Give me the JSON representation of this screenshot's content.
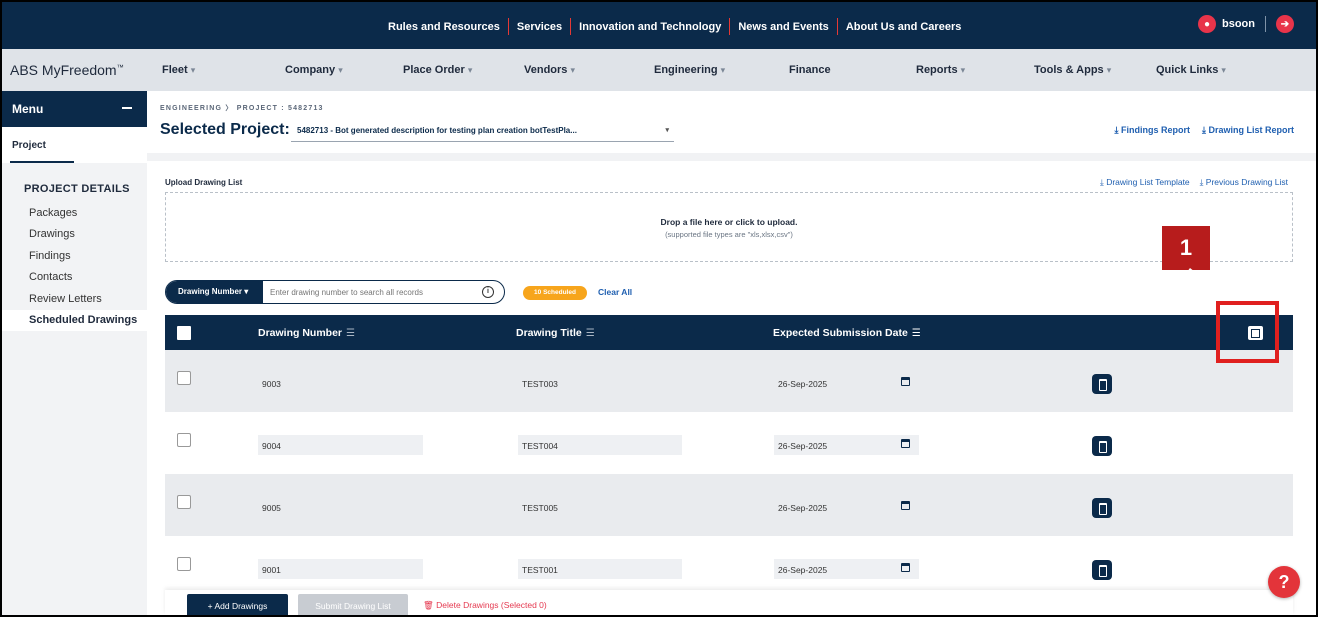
{
  "topnav": {
    "links": [
      "Rules and Resources",
      "Services",
      "Innovation and Technology",
      "News and Events",
      "About Us and Careers"
    ],
    "username": "bsoon"
  },
  "mainnav": {
    "brand": "ABS MyFreedom",
    "brand_mark": "™",
    "items": [
      {
        "label": "Fleet",
        "has_dropdown": true
      },
      {
        "label": "Company",
        "has_dropdown": true
      },
      {
        "label": "Place Order",
        "has_dropdown": true
      },
      {
        "label": "Vendors",
        "has_dropdown": true
      },
      {
        "label": "Engineering",
        "has_dropdown": true
      },
      {
        "label": "Finance",
        "has_dropdown": false
      },
      {
        "label": "Reports",
        "has_dropdown": true
      },
      {
        "label": "Tools & Apps",
        "has_dropdown": true
      },
      {
        "label": "Quick Links",
        "has_dropdown": true
      }
    ]
  },
  "sidebar": {
    "menu_label": "Menu",
    "project_tab": "Project",
    "section_title": "PROJECT DETAILS",
    "items": [
      "Packages",
      "Drawings",
      "Findings",
      "Contacts",
      "Review Letters",
      "Scheduled Drawings"
    ],
    "active_item": "Scheduled Drawings"
  },
  "header": {
    "breadcrumb": "ENGINEERING 〉 PROJECT : 5482713",
    "selected_label": "Selected Project:",
    "selected_value": "5482713 - Bot generated description for testing plan creation botTestPla...",
    "findings_report": "Findings Report",
    "drawing_list_report": "Drawing List Report"
  },
  "upload": {
    "label": "Upload Drawing List",
    "template_link": "Drawing List Template",
    "previous_link": "Previous Drawing List",
    "drop_title": "Drop a file here or click to upload.",
    "drop_subtitle": "(supported file types are \"xls,xlsx,csv\")"
  },
  "search": {
    "field_selector": "Drawing Number",
    "placeholder": "Enter drawing number to search all records",
    "scheduled_badge": "10 Scheduled",
    "clear_all": "Clear All"
  },
  "table": {
    "columns": [
      "Drawing Number",
      "Drawing Title",
      "Expected Submission Date"
    ],
    "rows": [
      {
        "number": "9003",
        "title": "TEST003",
        "date": "26-Sep-2025"
      },
      {
        "number": "9004",
        "title": "TEST004",
        "date": "26-Sep-2025"
      },
      {
        "number": "9005",
        "title": "TEST005",
        "date": "26-Sep-2025"
      },
      {
        "number": "9001",
        "title": "TEST001",
        "date": "26-Sep-2025"
      }
    ]
  },
  "annotation": {
    "callout_number": "1",
    "color": "#e0201f"
  },
  "footer": {
    "add_drawings": "Add Drawings",
    "submit_list": "Submit Drawing List",
    "delete_selected": "Delete Drawings (Selected 0)"
  },
  "help": {
    "label": "?"
  },
  "colors": {
    "primary": "#0b2a4a",
    "accent_red": "#e3343a",
    "link_blue": "#1f5fb0",
    "badge_orange": "#f7a51c"
  },
  "icons": [
    "user-avatar-icon",
    "logout-icon",
    "download-icon",
    "info-icon",
    "filter-icon",
    "column-chooser-icon",
    "kebab-menu-icon",
    "calendar-icon",
    "trash-icon",
    "plus-icon",
    "help-icon"
  ]
}
